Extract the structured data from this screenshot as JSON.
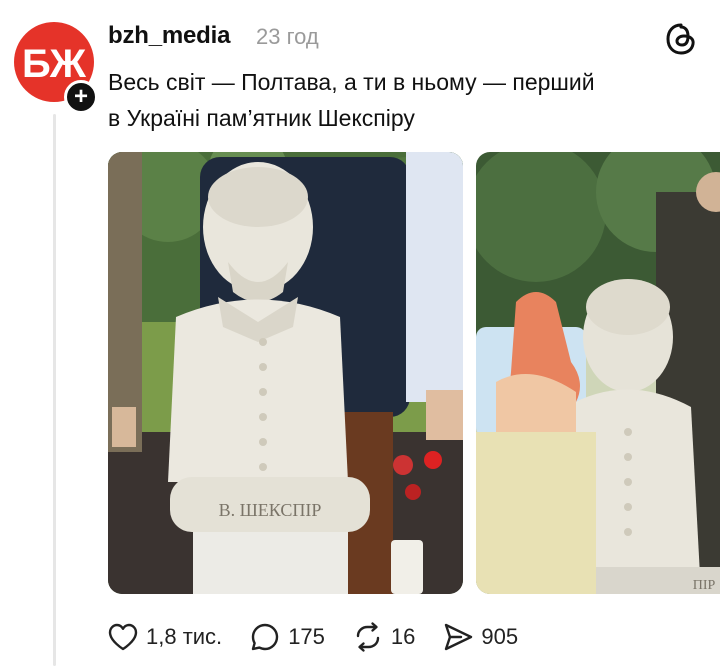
{
  "post": {
    "username": "bzh_media",
    "timestamp": "23 год",
    "text_line1": "Весь світ — Полтава, а ти в ньому — перший",
    "text_line2": "в Україні пам’ятник Шекспіру",
    "avatar_text": "БЖ",
    "sculpture_plaque": "В. ШЕКСПІР",
    "sculpture_plaque_partial": "ПІР"
  },
  "actions": {
    "likes": "1,8 тис.",
    "replies": "175",
    "reposts": "16",
    "shares": "905"
  },
  "icons": {
    "like": "heart-icon",
    "reply": "speech-bubble-icon",
    "repost": "repost-arrows-icon",
    "share": "paper-plane-icon",
    "brand": "threads-logo-icon",
    "follow": "plus-icon"
  },
  "colors": {
    "avatar_red": "#e53329",
    "text": "#111111",
    "muted": "#9a9a9a"
  }
}
